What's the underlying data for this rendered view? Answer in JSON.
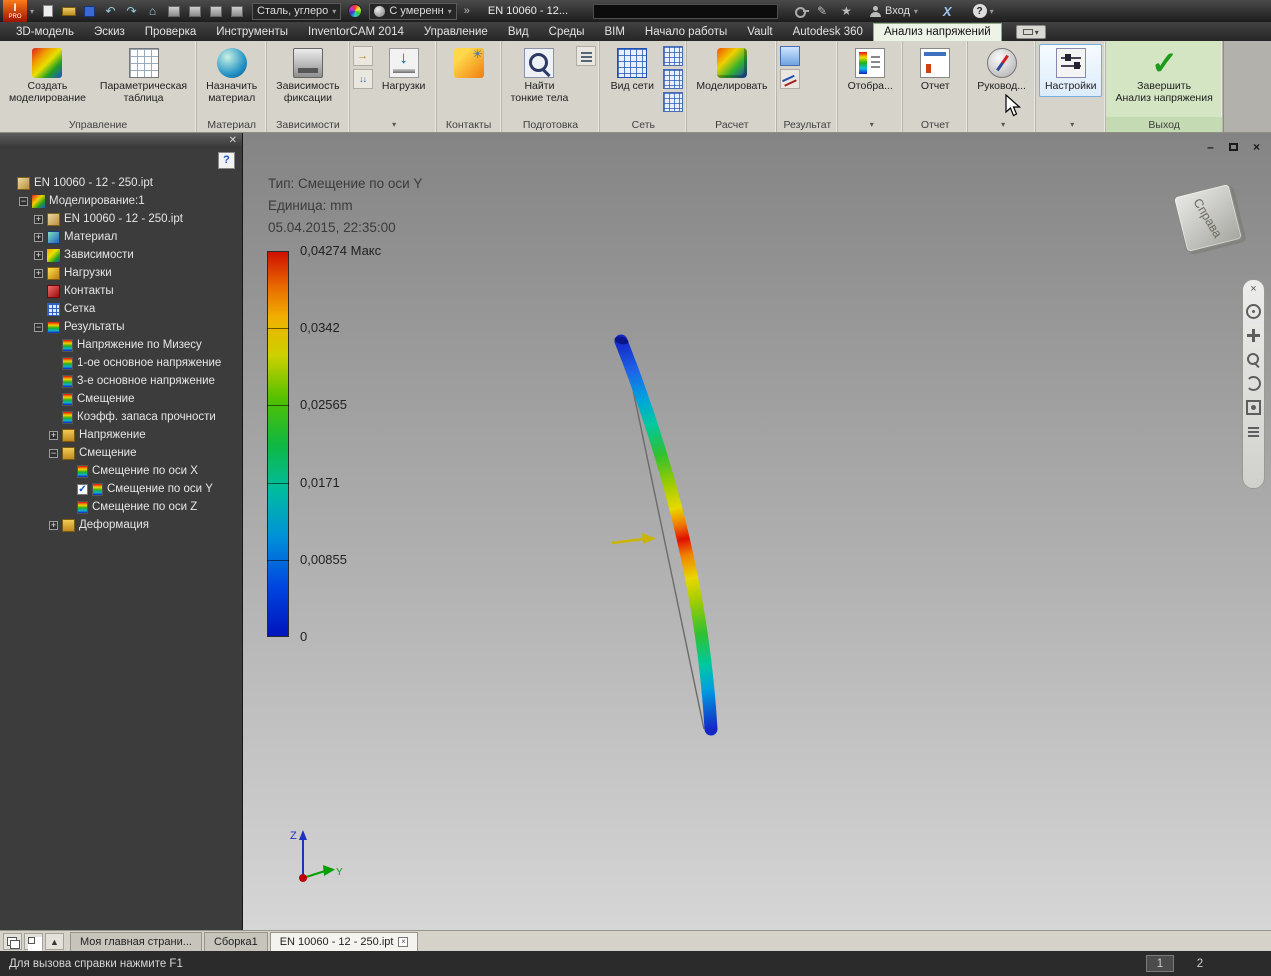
{
  "colors": {
    "ribbon_bg": "#d6d3cb",
    "env_green": "#d3e5c3",
    "highlight_blue": "#78aede",
    "legend_top": "#cf1000",
    "legend_bottom": "#0014bc"
  },
  "titlebar": {
    "logo_text": "PRO",
    "quick_icons": [
      "new-file",
      "open-folder",
      "save",
      "undo",
      "redo",
      "home",
      "sketch",
      "image",
      "tools",
      "web"
    ],
    "material_value": "Сталь, углеро",
    "appearance_value": "С умеренн",
    "overflow": "»",
    "doc_title": "EN 10060 - 12...",
    "search_value": "",
    "right_icons": [
      "key",
      "pencil",
      "star"
    ],
    "signin_label": "Вход",
    "exchange_label": "X",
    "help_label": "?"
  },
  "ribbon": {
    "active_tab": "Анализ напряжений",
    "tabs": [
      "3D-модель",
      "Эскиз",
      "Проверка",
      "Инструменты",
      "InventorCAM 2014",
      "Управление",
      "Вид",
      "Среды",
      "BIM",
      "Начало работы",
      "Vault",
      "Autodesk 360",
      "Анализ напряжений"
    ],
    "panels": [
      {
        "label": "Управление",
        "buttons": [
          {
            "label": "Создать\nмоделирование",
            "icon": "sim"
          },
          {
            "label": "Параметрическая\nтаблица",
            "icon": "table"
          }
        ]
      },
      {
        "label": "Материал",
        "buttons": [
          {
            "label": "Назначить\nматериал",
            "icon": "material"
          }
        ]
      },
      {
        "label": "Зависимости",
        "buttons": [
          {
            "label": "Зависимость\nфиксации",
            "icon": "constraint"
          }
        ]
      },
      {
        "label": "",
        "caret": true,
        "smalls_left": [
          "force",
          "pressure"
        ],
        "buttons": [
          {
            "label": "Нагрузки",
            "icon": "load"
          }
        ]
      },
      {
        "label": "Контакты",
        "buttons": [
          {
            "label": "",
            "icon": "contact"
          }
        ]
      },
      {
        "label": "Подготовка",
        "smalls_right": [
          "thin-list"
        ],
        "buttons": [
          {
            "label": "Найти\nтонкие тела",
            "icon": "find"
          }
        ]
      },
      {
        "label": "Сеть",
        "smalls_right": [
          "mesh-view",
          "mesh-local",
          "mesh-settings"
        ],
        "buttons": [
          {
            "label": "Вид сети",
            "icon": "mesh"
          }
        ]
      },
      {
        "label": "Расчет",
        "buttons": [
          {
            "label": "Моделировать",
            "icon": "simulate"
          }
        ]
      },
      {
        "label": "Результат",
        "smalls_left": [
          "probe",
          "chart"
        ]
      },
      {
        "label": "",
        "caret": true,
        "buttons": [
          {
            "label": "Отобра...",
            "icon": "legend"
          }
        ]
      },
      {
        "label": "Отчет",
        "buttons": [
          {
            "label": "Отчет",
            "icon": "report"
          }
        ]
      },
      {
        "label": "",
        "caret": true,
        "buttons": [
          {
            "label": "Руковод...",
            "icon": "guide"
          }
        ]
      },
      {
        "label": "",
        "caret": true,
        "buttons": [
          {
            "label": "Настройки",
            "icon": "settings",
            "highlight": true
          }
        ]
      },
      {
        "label": "Выход",
        "green": true,
        "buttons": [
          {
            "label": "Завершить\nАнализ напряжения",
            "icon": "finish"
          }
        ]
      }
    ]
  },
  "browser": {
    "close_glyph": "✕",
    "help_glyph": "?",
    "tree": [
      {
        "label": "EN 10060 - 12 - 250.ipt",
        "depth": 0,
        "icon": "part"
      },
      {
        "label": "Моделирование:1",
        "depth": 1,
        "icon": "sim",
        "expand": "minus"
      },
      {
        "label": "EN 10060 - 12 - 250.ipt",
        "depth": 2,
        "icon": "part",
        "expand": "plus"
      },
      {
        "label": "Материал",
        "depth": 2,
        "icon": "material",
        "expand": "plus"
      },
      {
        "label": "Зависимости",
        "depth": 2,
        "icon": "constraint",
        "expand": "plus"
      },
      {
        "label": "Нагрузки",
        "depth": 2,
        "icon": "load",
        "expand": "plus"
      },
      {
        "label": "Контакты",
        "depth": 2,
        "icon": "contact"
      },
      {
        "label": "Сетка",
        "depth": 2,
        "icon": "mesh"
      },
      {
        "label": "Результаты",
        "depth": 2,
        "icon": "results",
        "expand": "minus"
      },
      {
        "label": "Напряжение по Мизесу",
        "depth": 3,
        "icon": "result"
      },
      {
        "label": "1-ое основное напряжение",
        "depth": 3,
        "icon": "result"
      },
      {
        "label": "3-е основное напряжение",
        "depth": 3,
        "icon": "result"
      },
      {
        "label": "Смещение",
        "depth": 3,
        "icon": "result"
      },
      {
        "label": "Коэфф. запаса прочности",
        "depth": 3,
        "icon": "result"
      },
      {
        "label": "Напряжение",
        "depth": 3,
        "icon": "folder",
        "expand": "plus"
      },
      {
        "label": "Смещение",
        "depth": 3,
        "icon": "folder",
        "expand": "minus"
      },
      {
        "label": "Смещение по оси X",
        "depth": 4,
        "icon": "result"
      },
      {
        "label": "Смещение по оси Y",
        "depth": 4,
        "icon": "result",
        "checked": true
      },
      {
        "label": "Смещение по оси Z",
        "depth": 4,
        "icon": "result"
      },
      {
        "label": "Деформация",
        "depth": 3,
        "icon": "folder",
        "expand": "plus"
      }
    ]
  },
  "viewport": {
    "info_lines": [
      "Тип: Смещение по оси Y",
      "Единица: mm",
      "05.04.2015, 22:35:00"
    ],
    "legend": {
      "entries": [
        {
          "label": "0,04274 Макс",
          "frac": 0
        },
        {
          "label": "0,0342",
          "frac": 0.2
        },
        {
          "label": "0,02565",
          "frac": 0.4
        },
        {
          "label": "0,0171",
          "frac": 0.6
        },
        {
          "label": "0,00855",
          "frac": 0.8
        },
        {
          "label": "0",
          "frac": 1
        }
      ]
    },
    "viewcube_label": "Справа",
    "nav_icons": [
      "close",
      "wheel",
      "pan",
      "zoom",
      "orbit",
      "lookat",
      "more"
    ],
    "triad": {
      "z": "Z",
      "y": "Y"
    }
  },
  "doc_tabs": {
    "tabs": [
      {
        "label": "Моя главная страни...",
        "active": false
      },
      {
        "label": "Сборка1",
        "active": false
      },
      {
        "label": "EN 10060 - 12 - 250.ipt",
        "active": true
      }
    ]
  },
  "statusbar": {
    "hint": "Для вызова справки нажмите F1",
    "pages": [
      "1",
      "2"
    ],
    "active_page": "1"
  }
}
